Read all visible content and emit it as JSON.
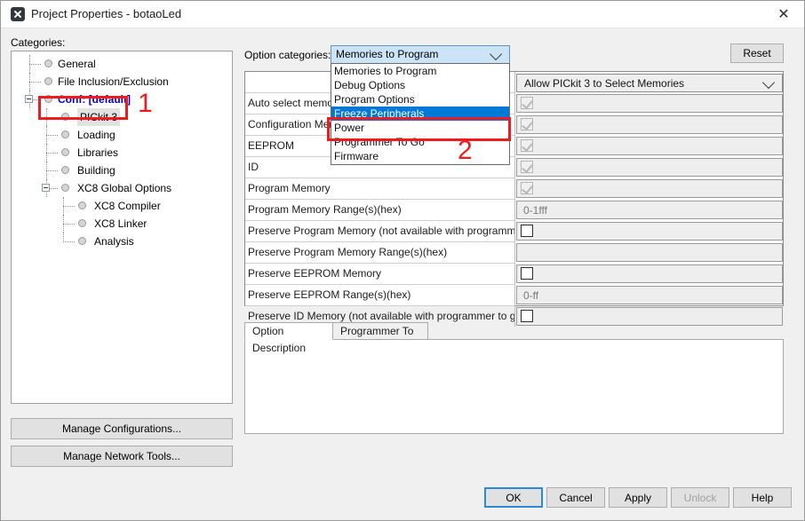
{
  "window": {
    "title": "Project Properties - botaoLed",
    "app_icon": "x-badge-icon",
    "close_label": "✕"
  },
  "left_pane": {
    "categories_label": "Categories:",
    "tree": [
      {
        "label": "General",
        "depth": 1,
        "expander": false,
        "selected": false,
        "conf": false
      },
      {
        "label": "File Inclusion/Exclusion",
        "depth": 1,
        "expander": false,
        "selected": false,
        "conf": false
      },
      {
        "label": "Conf: [default]",
        "depth": 1,
        "expander": true,
        "selected": false,
        "conf": true
      },
      {
        "label": "PICkit 3",
        "depth": 2,
        "expander": false,
        "selected": true,
        "conf": false
      },
      {
        "label": "Loading",
        "depth": 2,
        "expander": false,
        "selected": false,
        "conf": false
      },
      {
        "label": "Libraries",
        "depth": 2,
        "expander": false,
        "selected": false,
        "conf": false
      },
      {
        "label": "Building",
        "depth": 2,
        "expander": false,
        "selected": false,
        "conf": false
      },
      {
        "label": "XC8 Global Options",
        "depth": 2,
        "expander": true,
        "selected": false,
        "conf": false
      },
      {
        "label": "XC8 Compiler",
        "depth": 3,
        "expander": false,
        "selected": false,
        "conf": false
      },
      {
        "label": "XC8 Linker",
        "depth": 3,
        "expander": false,
        "selected": false,
        "conf": false
      },
      {
        "label": "Analysis",
        "depth": 3,
        "expander": false,
        "selected": false,
        "conf": false
      }
    ],
    "manage_configurations_label": "Manage Configurations...",
    "manage_network_tools_label": "Manage Network Tools..."
  },
  "right_pane": {
    "option_categories_label": "Option categories:",
    "option_categories_value": "Memories to Program",
    "reset_label": "Reset",
    "dropdown_options": [
      {
        "label": "Memories to Program",
        "highlight": false
      },
      {
        "label": "Debug Options",
        "highlight": false
      },
      {
        "label": "Program Options",
        "highlight": false
      },
      {
        "label": "Freeze Peripherals",
        "highlight": true
      },
      {
        "label": "Power",
        "highlight": false
      },
      {
        "label": "Programmer To Go",
        "highlight": false
      },
      {
        "label": "Firmware",
        "highlight": false
      }
    ],
    "table": {
      "header_right": "Allow PICkit 3 to Select Memories",
      "rows": [
        {
          "name": "Auto select memories and ranges",
          "kind": "checkbox-disabled-checked",
          "value": ""
        },
        {
          "name": "Configuration Memory",
          "kind": "checkbox-disabled-checked",
          "value": ""
        },
        {
          "name": "EEPROM",
          "kind": "checkbox-disabled-checked",
          "value": ""
        },
        {
          "name": "ID",
          "kind": "checkbox-disabled-checked",
          "value": ""
        },
        {
          "name": "Program Memory",
          "kind": "checkbox-disabled-checked",
          "value": ""
        },
        {
          "name": "Program Memory Range(s)(hex)",
          "kind": "text",
          "value": "0-1fff"
        },
        {
          "name": "Preserve Program Memory (not available with programmer t...",
          "kind": "checkbox",
          "value": ""
        },
        {
          "name": "Preserve Program Memory Range(s)(hex)",
          "kind": "text",
          "value": ""
        },
        {
          "name": "Preserve EEPROM Memory",
          "kind": "checkbox",
          "value": ""
        },
        {
          "name": "Preserve EEPROM Range(s)(hex)",
          "kind": "text",
          "value": "0-ff"
        },
        {
          "name": "Preserve ID Memory (not available with programmer to go)",
          "kind": "checkbox",
          "value": ""
        }
      ]
    },
    "tabs": [
      {
        "label": "Option Description",
        "active": true
      },
      {
        "label": "Programmer To Go",
        "active": false
      }
    ],
    "description_text": ""
  },
  "footer": {
    "buttons": [
      {
        "id": "ok",
        "label": "OK",
        "disabled": false,
        "default": true
      },
      {
        "id": "cancel",
        "label": "Cancel",
        "disabled": false,
        "default": false
      },
      {
        "id": "apply",
        "label": "Apply",
        "disabled": false,
        "default": false
      },
      {
        "id": "unlock",
        "label": "Unlock",
        "disabled": true,
        "default": false
      },
      {
        "id": "help",
        "label": "Help",
        "disabled": false,
        "default": false
      }
    ]
  },
  "annotations": [
    {
      "id": "1",
      "label": "1",
      "target": "sidebar-item-pickit-3"
    },
    {
      "id": "2",
      "label": "2",
      "target": "dropdown-option-power"
    }
  ],
  "colors": {
    "annotation_red": "#ee1c1c",
    "highlight_blue": "#0078d7",
    "conf_blue": "#0000c8",
    "window_bg": "#f0f0f0",
    "focus_blue": "#2a8ad4"
  }
}
